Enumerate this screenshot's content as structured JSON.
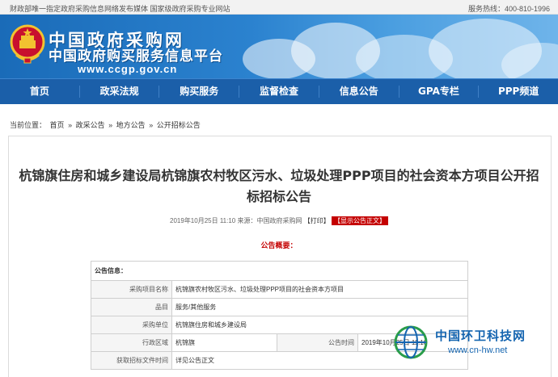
{
  "topbar": {
    "notice": "财政部唯一指定政府采购信息网络发布媒体 国家级政府采购专业网站",
    "hotline": "服务热线：400-810-1996"
  },
  "header": {
    "title": "中国政府采购网",
    "subtitle": "中国政府购买服务信息平台",
    "url": "www.ccgp.gov.cn"
  },
  "nav": {
    "items": [
      "首页",
      "政采法规",
      "购买服务",
      "监督检查",
      "信息公告",
      "GPA专栏",
      "PPP频道"
    ]
  },
  "breadcrumb": {
    "label": "当前位置：",
    "items": [
      "首页",
      "政采公告",
      "地方公告",
      "公开招标公告"
    ],
    "separator": "»"
  },
  "article": {
    "title": "杭锦旗住房和城乡建设局杭锦旗农村牧区污水、垃圾处理PPP项目的社会资本方项目公开招标招标公告",
    "date": "2019年10月25日 11:10",
    "source": "来源：中国政府采购网",
    "print": "【打印】",
    "toggle": "【显示公告正文】",
    "overview": "公告概要："
  },
  "info": {
    "header": "公告信息：",
    "rows": [
      {
        "label": "采购项目名称",
        "value": "杭锦旗农村牧区污水、垃圾处理PPP项目的社会资本方项目"
      },
      {
        "label": "品目",
        "value": "服务/其他服务"
      },
      {
        "label": "采购单位",
        "value": "杭锦旗住房和城乡建设局"
      },
      {
        "label": "行政区域",
        "value": "杭锦旗",
        "label2": "公告时间",
        "value2": "2019年10月25日 11:10"
      },
      {
        "label": "获取招标文件时间",
        "value": "详见公告正文"
      }
    ]
  },
  "watermark": {
    "name": "中国环卫科技网",
    "url": "www.cn-hw.net"
  },
  "colors": {
    "nav_bg": "#1b5fa9",
    "header_blue": "#2b82cf",
    "accent_red": "#c40000",
    "watermark_blue": "#1565b0"
  }
}
